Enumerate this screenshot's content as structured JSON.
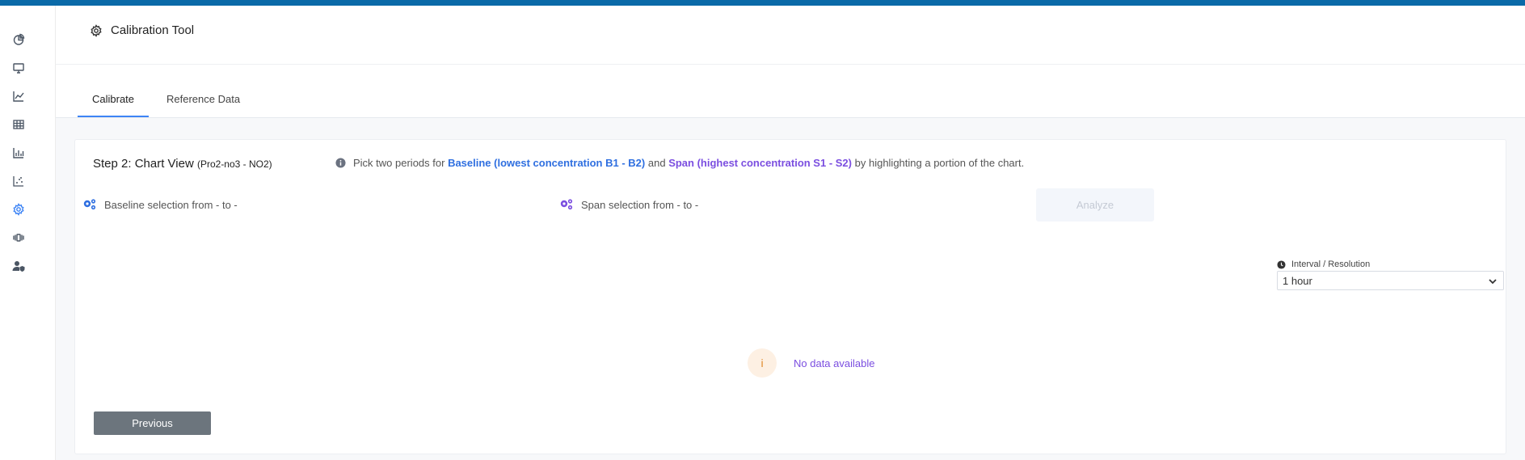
{
  "app": {
    "title": "Calibration Tool"
  },
  "sidebar": {
    "items": [
      {
        "icon": "pie-chart-icon"
      },
      {
        "icon": "monitor-icon"
      },
      {
        "icon": "line-chart-icon"
      },
      {
        "icon": "table-icon"
      },
      {
        "icon": "bar-chart-icon"
      },
      {
        "icon": "scatter-chart-icon"
      },
      {
        "icon": "gear-icon",
        "active": true
      },
      {
        "icon": "sensor-icon"
      },
      {
        "icon": "user-shield-icon"
      }
    ]
  },
  "tabs": [
    {
      "label": "Calibrate",
      "active": true
    },
    {
      "label": "Reference Data",
      "active": false
    }
  ],
  "step": {
    "title": "Step 2: Chart View",
    "subtitle": "(Pro2-no3 - NO2)"
  },
  "info": {
    "prefix": "Pick two periods for",
    "baseline": "Baseline (lowest concentration B1 - B2)",
    "and": "and",
    "span": "Span (highest concentration S1 - S2)",
    "suffix": "by highlighting a portion of the chart."
  },
  "selection": {
    "baseline": "Baseline selection from - to -",
    "span": "Span selection from - to -"
  },
  "buttons": {
    "analyze": "Analyze",
    "previous": "Previous"
  },
  "interval": {
    "label": "Interval / Resolution",
    "value": "1 hour"
  },
  "empty": {
    "icon_glyph": "i",
    "text": "No data available"
  },
  "colors": {
    "accent": "#3d84f5",
    "baseline": "#2f6fe0",
    "span": "#7b4ee0",
    "topbar": "#0a6aa8",
    "previous_button": "#6c757d"
  }
}
